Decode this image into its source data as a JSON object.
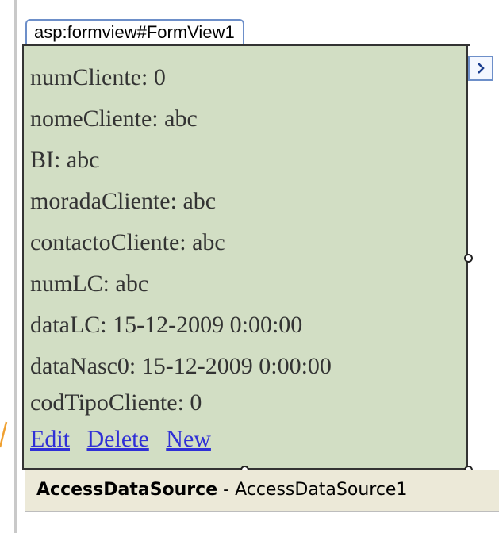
{
  "formview": {
    "tag_label": "asp:formview#FormView1",
    "fields": [
      {
        "label": "numCliente:",
        "value": "0"
      },
      {
        "label": "nomeCliente:",
        "value": "abc"
      },
      {
        "label": "BI:",
        "value": "abc"
      },
      {
        "label": "moradaCliente:",
        "value": "abc"
      },
      {
        "label": "contactoCliente:",
        "value": "abc"
      },
      {
        "label": "numLC:",
        "value": "abc"
      },
      {
        "label": "dataLC:",
        "value": "15-12-2009 0:00:00"
      },
      {
        "label": "dataNasc0:",
        "value": "15-12-2009 0:00:00"
      },
      {
        "label": "codTipoCliente:",
        "value": "0"
      }
    ],
    "links": {
      "edit": "Edit",
      "delete": "Delete",
      "new": "New"
    },
    "smart_tag_icon": "chevron-right-icon"
  },
  "datasource": {
    "type": "AccessDataSource",
    "separator": " - ",
    "id": "AccessDataSource1"
  },
  "colors": {
    "form_background": "#d2dec4",
    "link": "#2f2fd6",
    "tag_border": "#6d8fc9",
    "datasource_background": "#ece9d8"
  }
}
